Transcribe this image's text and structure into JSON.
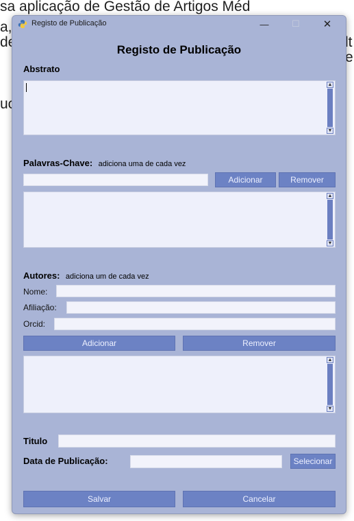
{
  "background": {
    "lines": [
      "sa aplicação de Gestão de Artigos Méd",
      "a,",
      "de",
      "uc"
    ],
    "right_fragments": [
      "lt",
      "e"
    ]
  },
  "window": {
    "title": "Registo de Publicação",
    "controls": {
      "minimize": "—",
      "maximize": "☐",
      "close": "✕"
    }
  },
  "form": {
    "title": "Registo de Publicação",
    "abstract": {
      "label": "Abstrato",
      "value": ""
    },
    "keywords": {
      "label": "Palavras-Chave:",
      "hint": "adiciona uma de cada vez",
      "input_value": "",
      "add_label": "Adicionar",
      "remove_label": "Remover",
      "items": []
    },
    "authors": {
      "label": "Autores:",
      "hint": "adiciona um de cada vez",
      "name_label": "Nome:",
      "affiliation_label": "Afiliação:",
      "orcid_label": "Orcid:",
      "add_label": "Adicionar",
      "remove_label": "Remover",
      "items": []
    },
    "title_field": {
      "label": "Titulo",
      "value": ""
    },
    "date_field": {
      "label": "Data de Publicação:",
      "value": "",
      "select_label": "Selecionar"
    },
    "save_label": "Salvar",
    "cancel_label": "Cancelar"
  },
  "colors": {
    "window_bg": "#a9b4d6",
    "button_bg": "#6c82c4",
    "field_bg": "#f2f3fb"
  }
}
